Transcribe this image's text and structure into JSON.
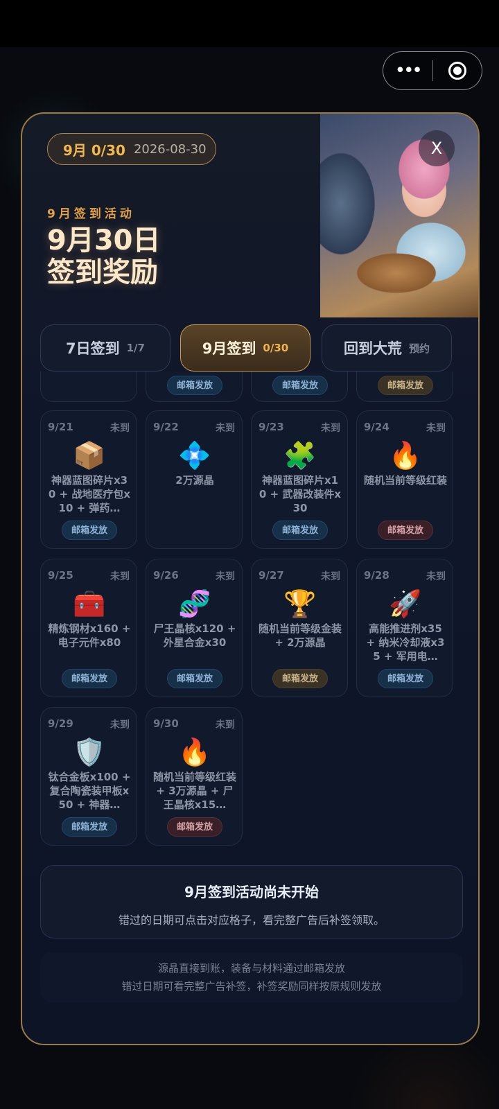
{
  "capsule": {
    "more_icon": "more-dots-icon",
    "close_icon": "target-icon"
  },
  "header": {
    "month_count": "9月 0/30",
    "date": "2026-08-30",
    "event_label": "9月签到活动",
    "title_line1": "9月30日",
    "title_line2": "签到奖励",
    "close_label": "X"
  },
  "tabs": [
    {
      "label": "7日签到",
      "count": "1/7"
    },
    {
      "label": "9月签到",
      "count": "0/30"
    },
    {
      "label": "回到大荒",
      "count": "预约"
    }
  ],
  "partial_row": [
    {
      "pill": "",
      "pill_color": "none"
    },
    {
      "pill": "邮箱发放",
      "pill_color": "blue"
    },
    {
      "pill": "邮箱发放",
      "pill_color": "blue"
    },
    {
      "pill": "邮箱发放",
      "pill_color": "gold"
    }
  ],
  "days": [
    {
      "date": "9/21",
      "status": "未到",
      "icon": "📦",
      "reward": "神器蓝图碎片x30 + 战地医疗包x10 + 弹药…",
      "pill": "邮箱发放",
      "pill_color": "blue"
    },
    {
      "date": "9/22",
      "status": "未到",
      "icon": "💠",
      "reward": "2万源晶",
      "pill": "",
      "pill_color": "none"
    },
    {
      "date": "9/23",
      "status": "未到",
      "icon": "🧩",
      "reward": "神器蓝图碎片x10 + 武器改装件x30",
      "pill": "邮箱发放",
      "pill_color": "blue"
    },
    {
      "date": "9/24",
      "status": "未到",
      "icon": "🔥",
      "reward": "随机当前等级红装",
      "pill": "邮箱发放",
      "pill_color": "red"
    },
    {
      "date": "9/25",
      "status": "未到",
      "icon": "🧰",
      "reward": "精炼钢材x160 + 电子元件x80",
      "pill": "邮箱发放",
      "pill_color": "blue"
    },
    {
      "date": "9/26",
      "status": "未到",
      "icon": "🧬",
      "reward": "尸王晶核x120 + 外星合金x30",
      "pill": "邮箱发放",
      "pill_color": "blue"
    },
    {
      "date": "9/27",
      "status": "未到",
      "icon": "🏆",
      "reward": "随机当前等级金装 + 2万源晶",
      "pill": "邮箱发放",
      "pill_color": "gold"
    },
    {
      "date": "9/28",
      "status": "未到",
      "icon": "🚀",
      "reward": "高能推进剂x35 + 纳米冷却液x35 + 军用电…",
      "pill": "邮箱发放",
      "pill_color": "blue"
    },
    {
      "date": "9/29",
      "status": "未到",
      "icon": "🛡️",
      "reward": "钛合金板x100 + 复合陶瓷装甲板x50 + 神器…",
      "pill": "邮箱发放",
      "pill_color": "blue"
    },
    {
      "date": "9/30",
      "status": "未到",
      "icon": "🔥",
      "reward": "随机当前等级红装 + 3万源晶 + 尸王晶核x15…",
      "pill": "邮箱发放",
      "pill_color": "red"
    }
  ],
  "notice": {
    "title": "9月签到活动尚未开始",
    "text": "错过的日期可点击对应格子，看完整广告后补签领取。"
  },
  "footer": {
    "line1": "源晶直接到账，装备与材料通过邮箱发放",
    "line2": "错过日期可看完整广告补签，补签奖励同样按原规则发放"
  },
  "colors": {
    "accent_gold": "#f2b84c",
    "border_gold": "#9a7a45",
    "panel_bg": "#10162a"
  }
}
